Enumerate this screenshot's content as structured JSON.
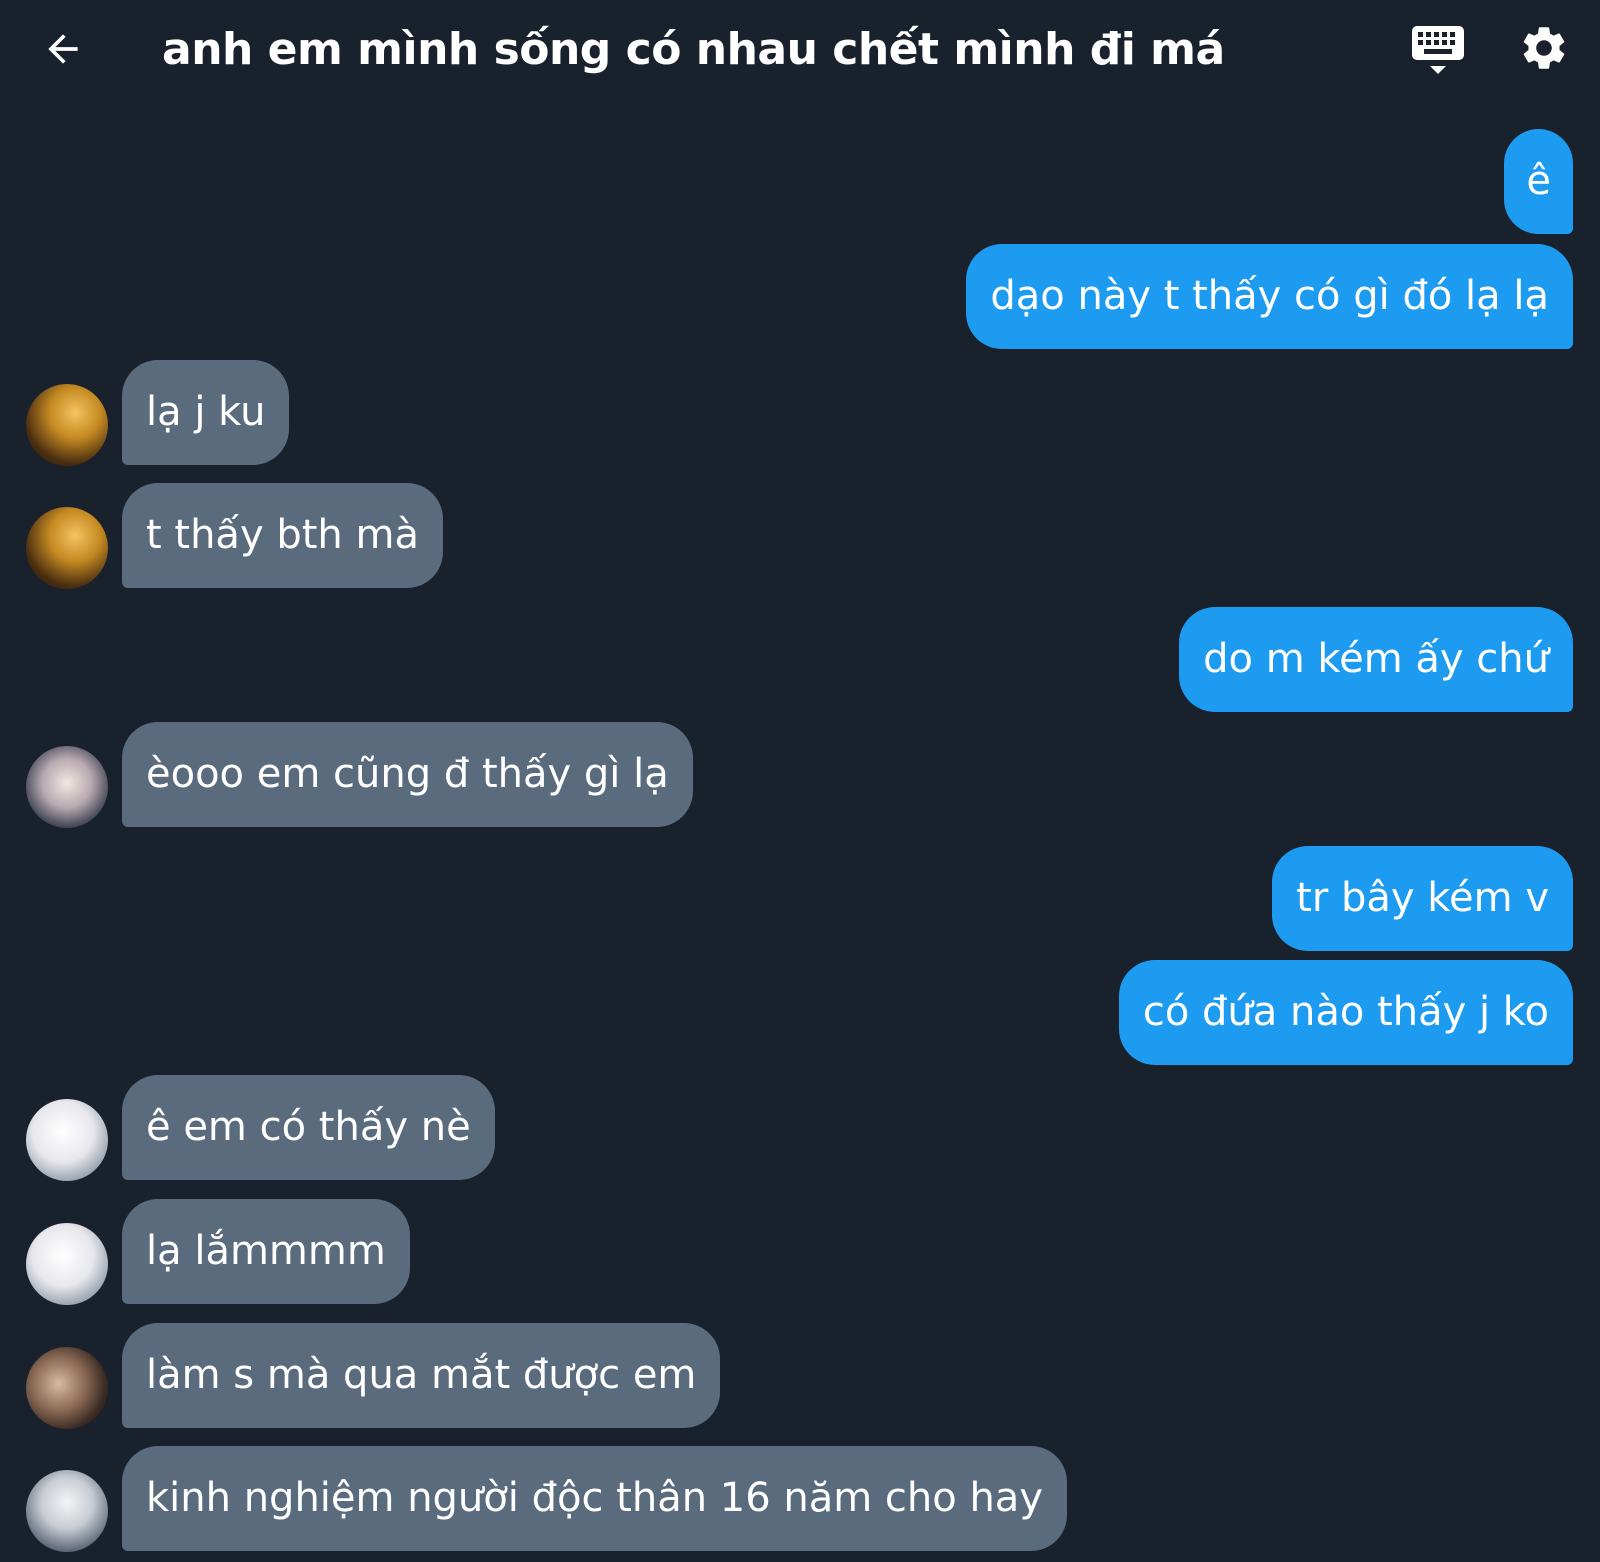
{
  "header": {
    "title": "anh em mình sống có nhau chết mình đi má",
    "back_icon": "arrow-left-icon",
    "keyboard_icon": "keyboard-icon",
    "settings_icon": "gear-icon"
  },
  "messages": [
    {
      "dir": "out",
      "text": "ê"
    },
    {
      "dir": "out",
      "text": "dạo này t thấy có gì đó lạ lạ"
    },
    {
      "dir": "in",
      "avatar": "gold-hair-avatar",
      "text": "lạ j ku"
    },
    {
      "dir": "in",
      "avatar": "gold-hair-avatar",
      "text": "t thấy bth mà"
    },
    {
      "dir": "out",
      "text": "do m kém ấy chứ"
    },
    {
      "dir": "in",
      "avatar": "sunglasses-avatar",
      "text": "èooo em cũng đ thấy gì lạ"
    },
    {
      "dir": "out",
      "text": "tr bây kém v"
    },
    {
      "dir": "out",
      "text": "có đứa nào thấy j ko"
    },
    {
      "dir": "in",
      "avatar": "white-shirt-avatar",
      "text": "ê em có thấy nè"
    },
    {
      "dir": "in",
      "avatar": "white-shirt-avatar",
      "text": "lạ lắmmmm"
    },
    {
      "dir": "in",
      "avatar": "girl-avatar",
      "text": "làm s mà qua mắt được em"
    },
    {
      "dir": "in",
      "avatar": "boy-avatar",
      "text": "kinh nghiệm người độc thân 16 năm cho hay"
    }
  ],
  "colors": {
    "background": "#19212c",
    "outgoing_bubble": "#1d9bf0",
    "incoming_bubble": "#5b6b7e",
    "text": "#ffffff"
  }
}
